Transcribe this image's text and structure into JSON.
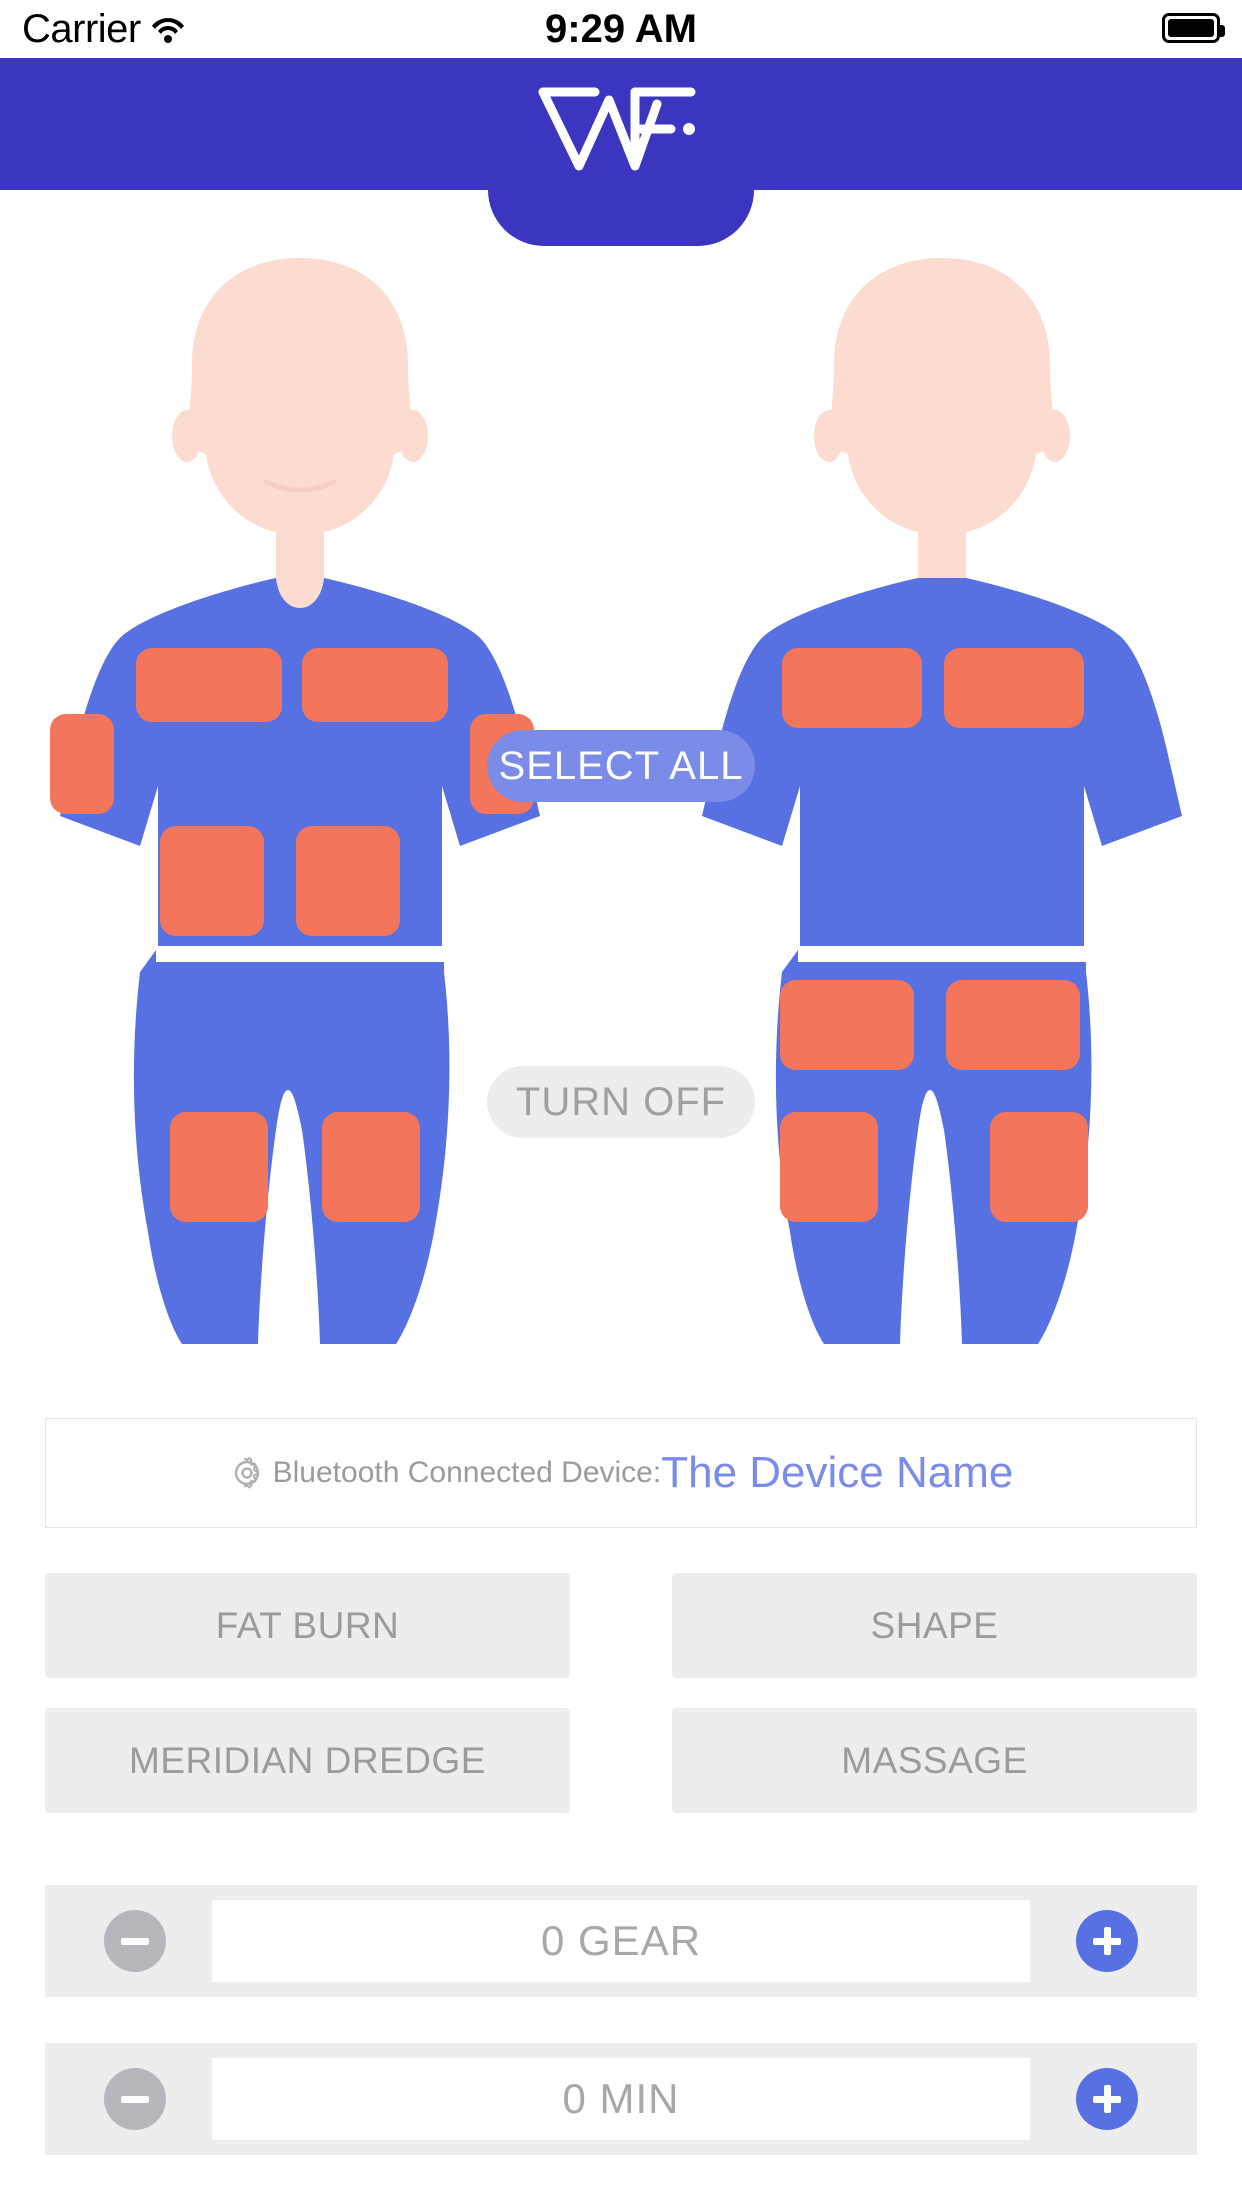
{
  "status_bar": {
    "carrier": "Carrier",
    "time": "9:29 AM",
    "wifi_icon": "wifi-icon",
    "battery_icon": "battery-full-icon"
  },
  "header": {
    "logo_name": "wf-brand-logo",
    "background_color": "#3b35bf"
  },
  "body_map": {
    "select_all_label": "SELECT ALL",
    "turn_off_label": "TURN OFF",
    "skin_color": "#fcdcd1",
    "suit_color": "#5771e3",
    "pad_color": "#f3755c",
    "front": {
      "view": "front",
      "pads": [
        {
          "name": "chest-left",
          "selected": true
        },
        {
          "name": "chest-right",
          "selected": true
        },
        {
          "name": "arm-left",
          "selected": true
        },
        {
          "name": "arm-right",
          "selected": true
        },
        {
          "name": "abdomen-left",
          "selected": true
        },
        {
          "name": "abdomen-right",
          "selected": true
        },
        {
          "name": "thigh-left",
          "selected": true
        },
        {
          "name": "thigh-right",
          "selected": true
        }
      ]
    },
    "back": {
      "view": "back",
      "pads": [
        {
          "name": "upper-back-left",
          "selected": true
        },
        {
          "name": "upper-back-right",
          "selected": true
        },
        {
          "name": "glute-left",
          "selected": true
        },
        {
          "name": "glute-right",
          "selected": true
        },
        {
          "name": "hamstring-left",
          "selected": true
        },
        {
          "name": "hamstring-right",
          "selected": true
        }
      ]
    }
  },
  "bluetooth": {
    "icon": "gear-icon",
    "label": "Bluetooth Connected Device:",
    "device_name": "The Device Name",
    "device_name_color": "#7b8ce8"
  },
  "modes": [
    {
      "label": "FAT BURN",
      "selected": false
    },
    {
      "label": "SHAPE",
      "selected": false
    },
    {
      "label": "MERIDIAN DREDGE",
      "selected": false
    },
    {
      "label": "MASSAGE",
      "selected": false
    }
  ],
  "steppers": [
    {
      "name": "gear",
      "value_label": "0 GEAR",
      "minus_icon": "minus-icon",
      "plus_icon": "plus-icon",
      "minus_color": "#b8b5bd",
      "plus_color": "#5771e3"
    },
    {
      "name": "minutes",
      "value_label": "0 MIN",
      "minus_icon": "minus-icon",
      "plus_icon": "plus-icon",
      "minus_color": "#b8b5bd",
      "plus_color": "#5771e3"
    }
  ]
}
